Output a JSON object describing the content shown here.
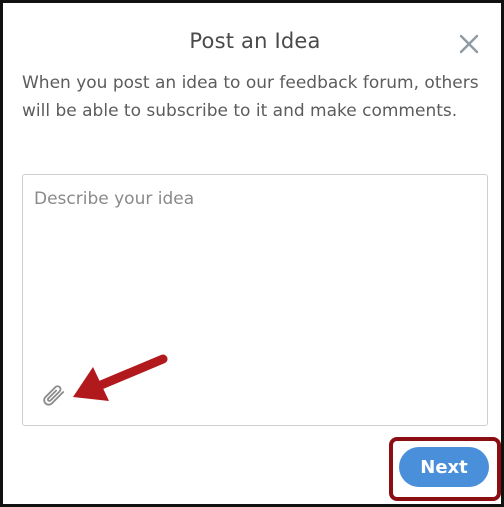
{
  "dialog": {
    "title": "Post an Idea",
    "description": "When you post an idea to our feedback forum, others will be able to subscribe to it and make comments.",
    "idea_input": {
      "placeholder": "Describe your idea",
      "value": ""
    },
    "next_label": "Next",
    "icons": {
      "close": "close-icon",
      "attach": "paperclip-icon"
    }
  },
  "annotations": {
    "arrow_color": "#b2191d",
    "highlight_color": "#8b0e12"
  },
  "colors": {
    "primary_button": "#4a8fd9",
    "title_text": "#4a4a4a",
    "body_text": "#5c5c5c",
    "placeholder_text": "#8a8a8a",
    "input_border": "#cfcfcf"
  }
}
